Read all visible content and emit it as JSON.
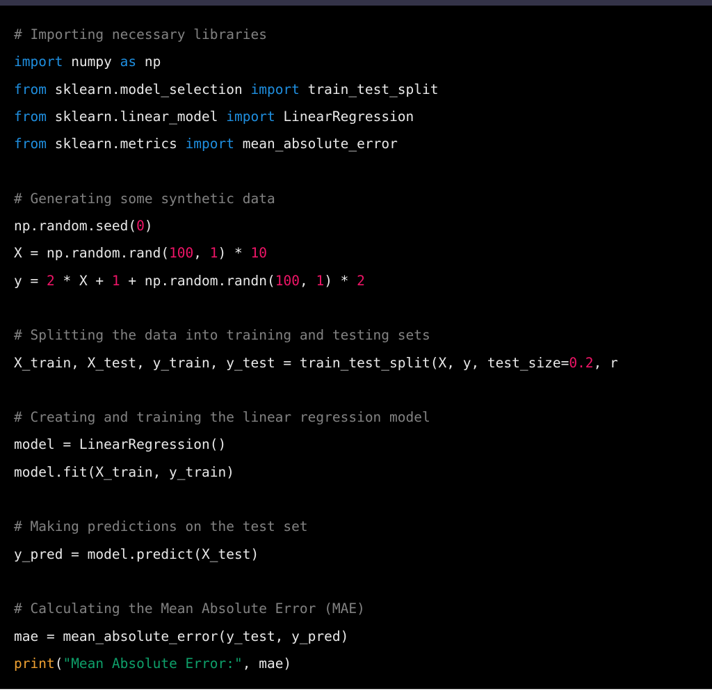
{
  "window": {
    "titlebar_color": "#343348",
    "background_color": "#000000",
    "bottom_rule_color": "#ffffff"
  },
  "theme": {
    "plain": "#e9e9e9",
    "comment": "#828282",
    "keyword": "#1f8fe0",
    "number": "#ef1567",
    "string": "#0ea06a",
    "builtin": "#efa132"
  },
  "code": {
    "language": "python",
    "lines": [
      {
        "id": 1,
        "text": "# Importing necessary libraries"
      },
      {
        "id": 2,
        "text": "import numpy as np"
      },
      {
        "id": 3,
        "text": "from sklearn.model_selection import train_test_split"
      },
      {
        "id": 4,
        "text": "from sklearn.linear_model import LinearRegression"
      },
      {
        "id": 5,
        "text": "from sklearn.metrics import mean_absolute_error"
      },
      {
        "id": 6,
        "text": ""
      },
      {
        "id": 7,
        "text": "# Generating some synthetic data"
      },
      {
        "id": 8,
        "text": "np.random.seed(0)"
      },
      {
        "id": 9,
        "text": "X = np.random.rand(100, 1) * 10"
      },
      {
        "id": 10,
        "text": "y = 2 * X + 1 + np.random.randn(100, 1) * 2"
      },
      {
        "id": 11,
        "text": ""
      },
      {
        "id": 12,
        "text": "# Splitting the data into training and testing sets"
      },
      {
        "id": 13,
        "text": "X_train, X_test, y_train, y_test = train_test_split(X, y, test_size=0.2, r"
      },
      {
        "id": 14,
        "text": ""
      },
      {
        "id": 15,
        "text": "# Creating and training the linear regression model"
      },
      {
        "id": 16,
        "text": "model = LinearRegression()"
      },
      {
        "id": 17,
        "text": "model.fit(X_train, y_train)"
      },
      {
        "id": 18,
        "text": ""
      },
      {
        "id": 19,
        "text": "# Making predictions on the test set"
      },
      {
        "id": 20,
        "text": "y_pred = model.predict(X_test)"
      },
      {
        "id": 21,
        "text": ""
      },
      {
        "id": 22,
        "text": "# Calculating the Mean Absolute Error (MAE)"
      },
      {
        "id": 23,
        "text": "mae = mean_absolute_error(y_test, y_pred)"
      },
      {
        "id": 24,
        "text": "print(\"Mean Absolute Error:\", mae)"
      }
    ],
    "tokens": [
      [
        {
          "t": "# Importing necessary libraries",
          "c": "comment"
        }
      ],
      [
        {
          "t": "import",
          "c": "kw"
        },
        {
          "t": " numpy ",
          "c": "plain"
        },
        {
          "t": "as",
          "c": "kw"
        },
        {
          "t": " np",
          "c": "plain"
        }
      ],
      [
        {
          "t": "from",
          "c": "kw"
        },
        {
          "t": " sklearn.model_selection ",
          "c": "plain"
        },
        {
          "t": "import",
          "c": "kw"
        },
        {
          "t": " train_test_split",
          "c": "plain"
        }
      ],
      [
        {
          "t": "from",
          "c": "kw"
        },
        {
          "t": " sklearn.linear_model ",
          "c": "plain"
        },
        {
          "t": "import",
          "c": "kw"
        },
        {
          "t": " LinearRegression",
          "c": "plain"
        }
      ],
      [
        {
          "t": "from",
          "c": "kw"
        },
        {
          "t": " sklearn.metrics ",
          "c": "plain"
        },
        {
          "t": "import",
          "c": "kw"
        },
        {
          "t": " mean_absolute_error",
          "c": "plain"
        }
      ],
      [
        {
          "t": "",
          "c": "plain"
        }
      ],
      [
        {
          "t": "# Generating some synthetic data",
          "c": "comment"
        }
      ],
      [
        {
          "t": "np.random.seed(",
          "c": "plain"
        },
        {
          "t": "0",
          "c": "num"
        },
        {
          "t": ")",
          "c": "plain"
        }
      ],
      [
        {
          "t": "X = np.random.rand(",
          "c": "plain"
        },
        {
          "t": "100",
          "c": "num"
        },
        {
          "t": ", ",
          "c": "plain"
        },
        {
          "t": "1",
          "c": "num"
        },
        {
          "t": ") * ",
          "c": "plain"
        },
        {
          "t": "10",
          "c": "num"
        }
      ],
      [
        {
          "t": "y = ",
          "c": "plain"
        },
        {
          "t": "2",
          "c": "num"
        },
        {
          "t": " * X + ",
          "c": "plain"
        },
        {
          "t": "1",
          "c": "num"
        },
        {
          "t": " + np.random.randn(",
          "c": "plain"
        },
        {
          "t": "100",
          "c": "num"
        },
        {
          "t": ", ",
          "c": "plain"
        },
        {
          "t": "1",
          "c": "num"
        },
        {
          "t": ") * ",
          "c": "plain"
        },
        {
          "t": "2",
          "c": "num"
        }
      ],
      [
        {
          "t": "",
          "c": "plain"
        }
      ],
      [
        {
          "t": "# Splitting the data into training and testing sets",
          "c": "comment"
        }
      ],
      [
        {
          "t": "X_train, X_test, y_train, y_test = train_test_split(X, y, test_size=",
          "c": "plain"
        },
        {
          "t": "0.2",
          "c": "num"
        },
        {
          "t": ", r",
          "c": "plain"
        }
      ],
      [
        {
          "t": "",
          "c": "plain"
        }
      ],
      [
        {
          "t": "# Creating and training the linear regression model",
          "c": "comment"
        }
      ],
      [
        {
          "t": "model = LinearRegression()",
          "c": "plain"
        }
      ],
      [
        {
          "t": "model.fit(X_train, y_train)",
          "c": "plain"
        }
      ],
      [
        {
          "t": "",
          "c": "plain"
        }
      ],
      [
        {
          "t": "# Making predictions on the test set",
          "c": "comment"
        }
      ],
      [
        {
          "t": "y_pred = model.predict(X_test)",
          "c": "plain"
        }
      ],
      [
        {
          "t": "",
          "c": "plain"
        }
      ],
      [
        {
          "t": "# Calculating the Mean Absolute Error (MAE)",
          "c": "comment"
        }
      ],
      [
        {
          "t": "mae = mean_absolute_error(y_test, y_pred)",
          "c": "plain"
        }
      ],
      [
        {
          "t": "print",
          "c": "builtin"
        },
        {
          "t": "(",
          "c": "plain"
        },
        {
          "t": "\"Mean Absolute Error:\"",
          "c": "str"
        },
        {
          "t": ", mae)",
          "c": "plain"
        }
      ]
    ]
  }
}
